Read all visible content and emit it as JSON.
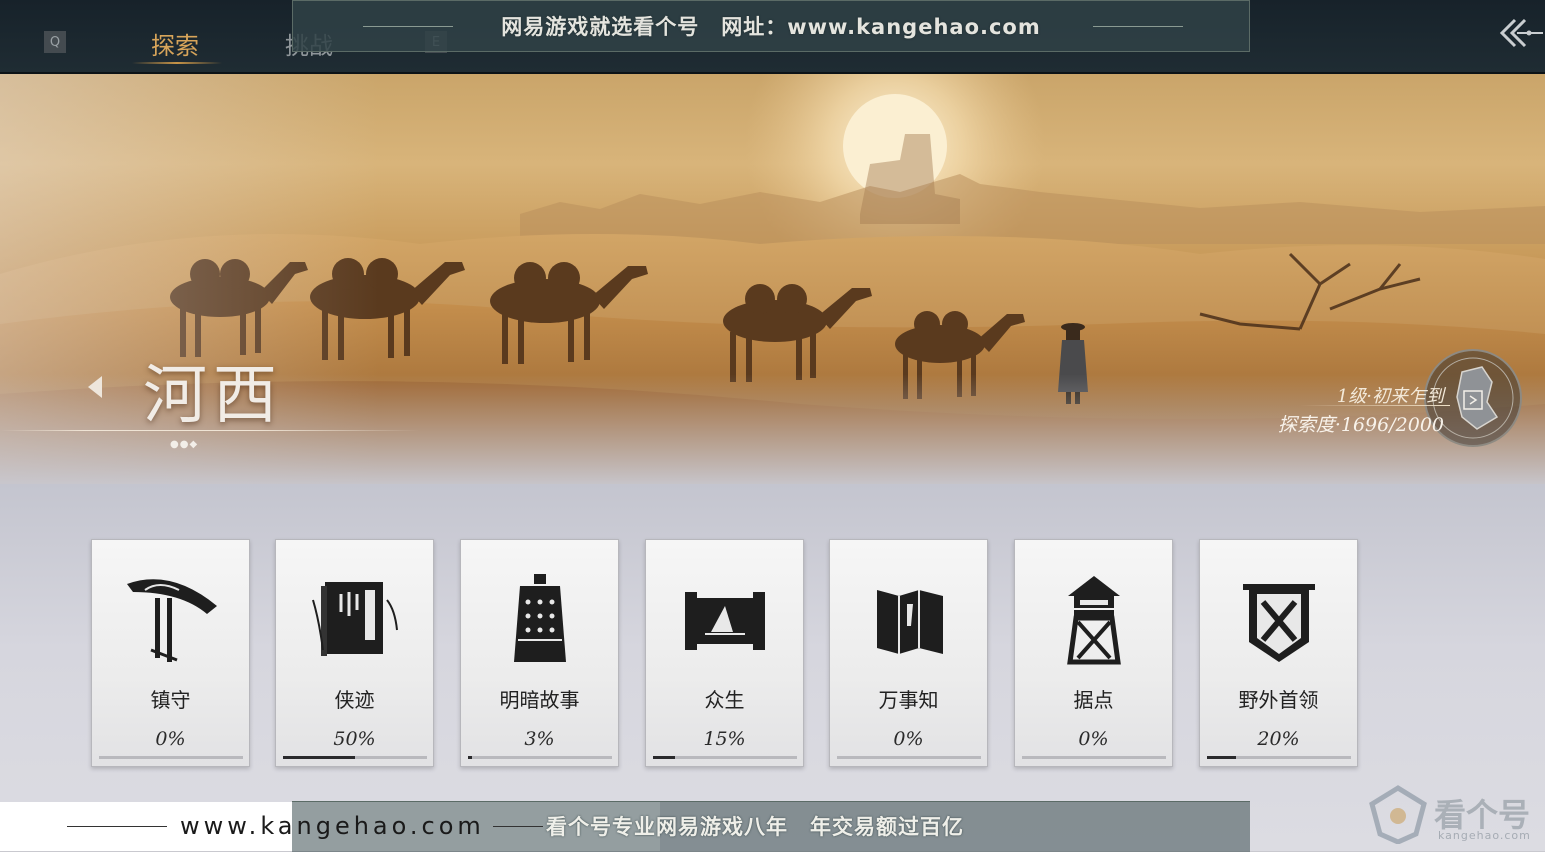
{
  "nav": {
    "left_key": "Q",
    "right_key": "E",
    "tabs": [
      {
        "label": "探索",
        "active": true
      },
      {
        "label": "挑战",
        "active": false
      }
    ]
  },
  "watermark": {
    "top_text": "网易游戏就选看个号　网址：www.kangehao.com",
    "bottom_url": "www.kangehao.com",
    "bottom_slogan": "看个号专业网易游戏八年　年交易额过百亿",
    "logo_name": "看个号",
    "logo_sub": "kangehao.com"
  },
  "region": {
    "name": "河西",
    "dots": "●●◆",
    "level": "1级·初来乍到",
    "progress": "探索度·1696/2000",
    "explored": 1696,
    "total": 2000
  },
  "categories": [
    {
      "label": "镇守",
      "percent": "0%",
      "value": 0,
      "icon": "hat-icon"
    },
    {
      "label": "侠迹",
      "percent": "50%",
      "value": 50,
      "icon": "book-icon"
    },
    {
      "label": "明暗故事",
      "percent": "3%",
      "value": 3,
      "icon": "bell-icon"
    },
    {
      "label": "众生",
      "percent": "15%",
      "value": 15,
      "icon": "scroll-icon"
    },
    {
      "label": "万事知",
      "percent": "0%",
      "value": 0,
      "icon": "folded-map-icon"
    },
    {
      "label": "据点",
      "percent": "0%",
      "value": 0,
      "icon": "watchtower-icon"
    },
    {
      "label": "野外首领",
      "percent": "20%",
      "value": 20,
      "icon": "crossed-swords-banner-icon"
    }
  ],
  "colors": {
    "tab_active": "#d8a55a",
    "tab_inactive": "#8f969a",
    "topbar": "#1b262d",
    "progress_fill": "#2a2a2c"
  }
}
